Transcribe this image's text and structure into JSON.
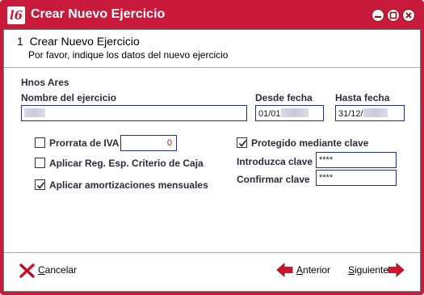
{
  "window": {
    "title": "Crear Nuevo Ejercicio",
    "app_icon_text": "l6"
  },
  "header": {
    "step_title": "1  Crear Nuevo Ejercicio",
    "step_subtitle": "Por favor, indique los datos del nuevo ejercicio"
  },
  "form": {
    "company": "Hnos Ares",
    "nombre_label": "Nombre del ejercicio",
    "nombre_value": "",
    "desde_label": "Desde fecha",
    "desde_value": "01/01",
    "hasta_label": "Hasta fecha",
    "hasta_value": "31/12/",
    "prorrata_label": "Prorrata de IVA",
    "prorrata_checked": false,
    "prorrata_value": "0",
    "criterio_caja_label": "Aplicar Reg. Esp. Criterio de Caja",
    "criterio_caja_checked": false,
    "amortizaciones_label": "Aplicar amortizaciones mensuales",
    "amortizaciones_checked": true,
    "protegido_label": "Protegido mediante clave",
    "protegido_checked": true,
    "introduzca_label": "Introduzca clave",
    "introduzca_value": "****",
    "confirmar_label": "Confirmar clave",
    "confirmar_value": "****"
  },
  "footer": {
    "cancel_accel": "C",
    "cancel_rest": "ancelar",
    "prev_accel": "A",
    "prev_rest": "nterior",
    "next_accel": "S",
    "next_rest": "iguiente"
  },
  "colors": {
    "titlebar": "#c81a3a",
    "field_border": "#1f2d99",
    "accent_red": "#d0142c"
  }
}
